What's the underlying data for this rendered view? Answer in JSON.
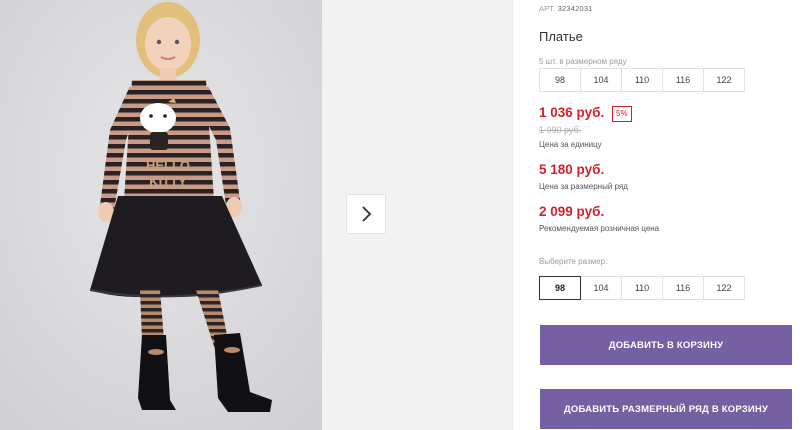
{
  "product": {
    "sku_label": "АРТ.",
    "sku_value": "32342031",
    "title": "Платье",
    "image_alt": "product-photo"
  },
  "range": {
    "label": "5 шт. в размерном ряду",
    "sizes": [
      "98",
      "104",
      "110",
      "116",
      "122"
    ]
  },
  "prices": {
    "unit_price": "1 036 руб.",
    "discount": "5%",
    "old_price": "1 090 руб.",
    "unit_caption": "Цена за единицу",
    "range_price": "5 180 руб.",
    "range_caption": "Цена за размерный ряд",
    "retail_price": "2 099 руб.",
    "retail_caption": "Рекомендуемая розничная цена"
  },
  "size_select": {
    "label": "Выберите размер:",
    "sizes": [
      "98",
      "104",
      "110",
      "116",
      "122"
    ],
    "selected": "98"
  },
  "buttons": {
    "add_to_cart": "ДОБАВИТЬ В КОРЗИНУ",
    "add_range_to_cart": "ДОБАВИТЬ РАЗМЕРНЫЙ РЯД В КОРЗИНУ"
  },
  "colors": {
    "accent_purple": "#7460a2",
    "price_red": "#d6202a"
  },
  "icons": {
    "next": "chevron-right-icon"
  }
}
